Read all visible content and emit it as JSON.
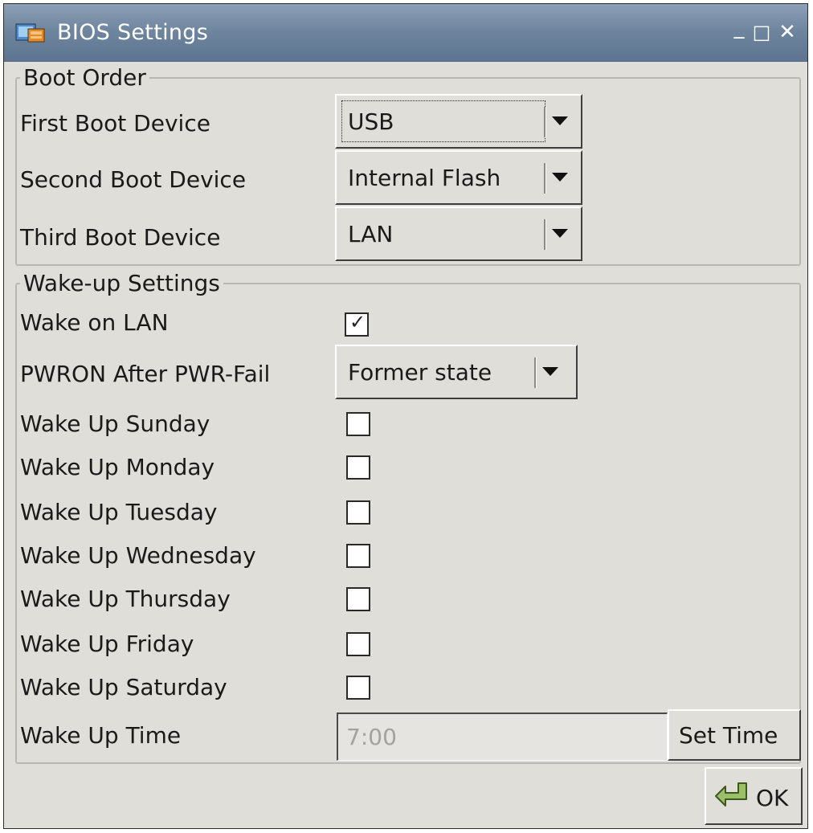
{
  "window": {
    "title": "BIOS Settings",
    "controls": {
      "minimize": "_",
      "maximize": "□",
      "close": "✕"
    }
  },
  "boot_order": {
    "legend": "Boot Order",
    "first": {
      "label": "First Boot Device",
      "value": "USB"
    },
    "second": {
      "label": "Second Boot Device",
      "value": "Internal Flash"
    },
    "third": {
      "label": "Third Boot Device",
      "value": "LAN"
    }
  },
  "wakeup": {
    "legend": "Wake-up Settings",
    "wake_on_lan": {
      "label": "Wake on LAN",
      "checked": true
    },
    "pwron": {
      "label": "PWRON After PWR-Fail",
      "value": "Former state"
    },
    "days": [
      {
        "label": "Wake Up Sunday",
        "checked": false
      },
      {
        "label": "Wake Up Monday",
        "checked": false
      },
      {
        "label": "Wake Up Tuesday",
        "checked": false
      },
      {
        "label": "Wake Up Wednesday",
        "checked": false
      },
      {
        "label": "Wake Up Thursday",
        "checked": false
      },
      {
        "label": "Wake Up Friday",
        "checked": false
      },
      {
        "label": "Wake Up Saturday",
        "checked": false
      }
    ],
    "time": {
      "label": "Wake Up Time",
      "value": "7:00",
      "button": "Set Time"
    }
  },
  "footer": {
    "ok_label": "OK"
  },
  "colors": {
    "titlebar": "#6f869f",
    "background": "#e0ded9"
  }
}
